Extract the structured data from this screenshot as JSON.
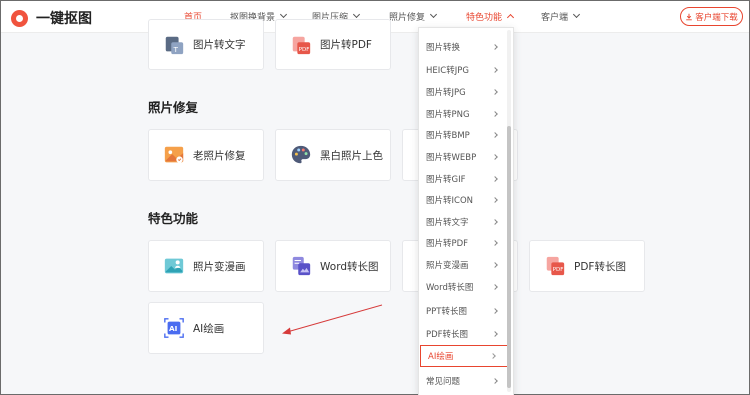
{
  "brand": {
    "name": "一键抠图"
  },
  "nav": {
    "items": [
      {
        "label": "首页",
        "active": true
      },
      {
        "label": "抠图换背景"
      },
      {
        "label": "图片压缩"
      },
      {
        "label": "照片修复"
      },
      {
        "label": "特色功能",
        "open": true
      },
      {
        "label": "客户端"
      }
    ],
    "download_label": "客户端下载"
  },
  "sections": {
    "top_cards": [
      "图片转文字",
      "图片转PDF"
    ],
    "repair": {
      "title": "照片修复",
      "cards": [
        "老照片修复",
        "黑白照片上色"
      ]
    },
    "special": {
      "title": "特色功能",
      "cards": [
        "照片变漫画",
        "Word转长图",
        "PDF转长图",
        "AI绘画"
      ]
    }
  },
  "dropdown": {
    "items": [
      "图片转换",
      "HEIC转JPG",
      "图片转JPG",
      "图片转PNG",
      "图片转BMP",
      "图片转WEBP",
      "图片转GIF",
      "图片转ICON",
      "图片转文字",
      "图片转PDF",
      "照片变漫画",
      "Word转长图",
      "PPT转长图",
      "PDF转长图",
      "AI绘画",
      "常见问题"
    ],
    "selected": "AI绘画"
  },
  "colors": {
    "accent": "#e8452f",
    "annotation_arrow": "#d63a3a"
  }
}
